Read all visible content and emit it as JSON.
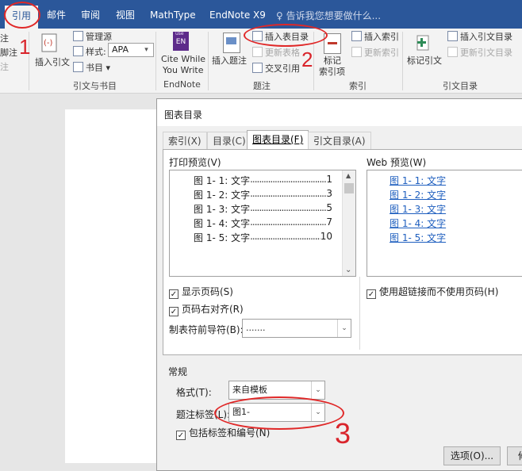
{
  "ribbon_tabs": [
    "引用",
    "邮件",
    "审阅",
    "视图",
    "MathType",
    "EndNote X9"
  ],
  "tell_me": "告诉我您想要做什么...",
  "left_edge": [
    "注",
    "脚注",
    "注"
  ],
  "citations": {
    "insert_citation": "插入引文",
    "manage_sources": "管理源",
    "style_label": "样式:",
    "style_value": "APA",
    "bibliography": "书目",
    "group_label": "引文与书目"
  },
  "endnote": {
    "badge": "EN",
    "badge_top": "use",
    "label_line1": "Cite While",
    "label_line2": "You Write",
    "group_label": "EndNote"
  },
  "captions": {
    "insert_caption": "插入题注",
    "insert_table_of_figures": "插入表目录",
    "update_table": "更新表格",
    "cross_reference": "交叉引用",
    "group_label": "题注"
  },
  "index": {
    "mark_entry_line1": "标记",
    "mark_entry_line2": "索引项",
    "insert_index": "插入索引",
    "update_index": "更新索引",
    "group_label": "索引"
  },
  "toa": {
    "mark_citation": "标记引文",
    "insert_toa": "插入引文目录",
    "update_toa": "更新引文目录",
    "group_label": "引文目录"
  },
  "dialog": {
    "title": "图表目录",
    "tabs": [
      "索引(X)",
      "目录(C)",
      "图表目录(F)",
      "引文目录(A)"
    ],
    "print_preview_label": "打印预览(V)",
    "print_entries": [
      {
        "label": "图 1- 1:  文字",
        "page": "1"
      },
      {
        "label": "图 1- 2:  文字",
        "page": "3"
      },
      {
        "label": "图 1- 3:  文字",
        "page": "5"
      },
      {
        "label": "图 1- 4:  文字",
        "page": "7"
      },
      {
        "label": "图 1- 5:  文字",
        "page": "10"
      }
    ],
    "web_preview_label": "Web 预览(W)",
    "web_entries": [
      "图 1- 1:  文字",
      "图 1- 2:  文字",
      "图 1- 3:  文字",
      "图 1- 4:  文字",
      "图 1- 5:  文字"
    ],
    "show_page_numbers": "显示页码(S)",
    "right_align": "页码右对齐(R)",
    "use_hyperlinks": "使用超链接而不使用页码(H)",
    "tab_leader_label": "制表符前导符(B):",
    "tab_leader_value": ".......",
    "general_label": "常规",
    "format_label": "格式(T):",
    "format_value": "来自模板",
    "caption_label_label": "题注标签(L):",
    "caption_label_value": "图1-",
    "include_label": "包括标签和编号(N)",
    "options_button": "选项(O)...",
    "modify_button": "修"
  },
  "annotations": [
    "1",
    "2",
    "3"
  ],
  "colors": {
    "ribbon_blue": "#2b579a",
    "annotation_red": "#e02828",
    "link_blue": "#1f5fbf"
  }
}
